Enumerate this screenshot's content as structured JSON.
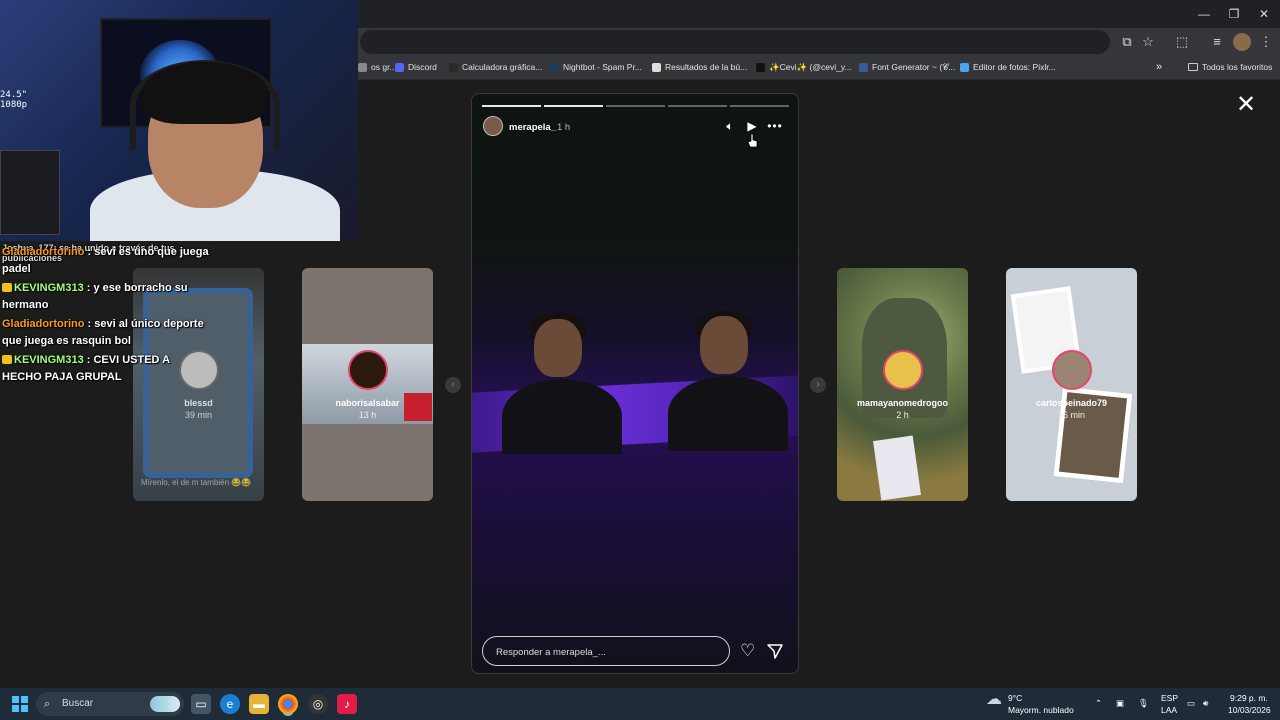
{
  "window": {
    "minimize": "—",
    "maximize": "❐",
    "close": "✕"
  },
  "bookmarks": [
    {
      "label": "os gr...",
      "color": "#888"
    },
    {
      "label": "Discord",
      "color": "#5865f2"
    },
    {
      "label": "Calculadora gráfica...",
      "color": "#2a2a2a"
    },
    {
      "label": "Nightbot - Spam Pr...",
      "color": "#1e3a5a"
    },
    {
      "label": "Resultados de la bú...",
      "color": "#ddd"
    },
    {
      "label": "✨Cevi✨ (@cevi_y...",
      "color": "#111"
    },
    {
      "label": "Font Generator ~ (𝓒...",
      "color": "#3b5998"
    },
    {
      "label": "Editor de fotos: Pixlr...",
      "color": "#49a6e9"
    }
  ],
  "bookmarks_more": "»",
  "bookmarks_all": "Todos los favoritos",
  "story": {
    "user": "merapela_",
    "time": "1 h",
    "reply_placeholder": "Responder a merapela_...",
    "progress_segments": 5,
    "progress_active": 2
  },
  "cards": [
    {
      "user": "blessd",
      "time": "39 min",
      "caption": "Mírenlo, el de m también 😂😂"
    },
    {
      "user": "naborisalsabar",
      "time": "13 h"
    },
    {
      "user": "mamayanomedrogoo",
      "time": "2 h"
    },
    {
      "user": "carlospeinado79",
      "time": "36 min"
    }
  ],
  "cam_overlay": "24.5\"\n1080p",
  "chat_system": "Joshua_177: se ha unido a través de tus publicaciones",
  "chat": [
    {
      "user": "Gladiadortorino",
      "color": "orange",
      "badge": false,
      "text": "sevi es uno que juega padel"
    },
    {
      "user": "KEVINGM313",
      "color": "green",
      "badge": true,
      "text": "y ese borracho su hermano"
    },
    {
      "user": "Gladiadortorino",
      "color": "orange",
      "badge": false,
      "text": "sevi al único deporte que juega es rasquin bol"
    },
    {
      "user": "KEVINGM313",
      "color": "green",
      "badge": true,
      "text": "CEVI USTED A HECHO PAJA GRUPAL"
    }
  ],
  "taskbar": {
    "search": "Buscar",
    "weather_temp": "9°C",
    "weather_desc": "Mayorm. nublado",
    "lang1": "ESP",
    "lang2": "LAA",
    "time": "9:29 p. m.",
    "date": "10/03/2026"
  }
}
